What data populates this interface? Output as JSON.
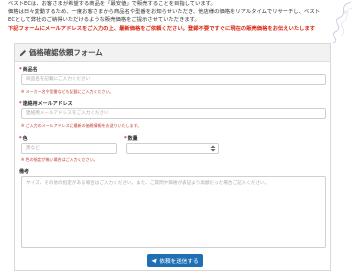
{
  "intro": {
    "line1": "ベストECは、お客さまが希望する商品を「最安値」で販売することを目指しています。",
    "line2": "価格は日々変動するため、一度お客さまから商品名や型番をお知らせいただき、他店様の価格をリアルタイムでリサーチし、ベスト",
    "line3": "ECとして弊社のご納得いただけるような販売価格をご提示させていただきます。",
    "line4": "下記フォームにメールアドレスをご入力の上、最新価格をご依頼ください。登録不要ですぐに現在の販売価格をお伝えいたします"
  },
  "form": {
    "title": "価格確認依頼フォーム",
    "product": {
      "label": "商品名",
      "placeholder": "商品名を記載にご入力ください",
      "hint": "※ メーカー名や型番なども記載にご入力ください。"
    },
    "email": {
      "label": "連絡用メールアドレス",
      "placeholder": "連絡用メールアドレスをご入力ください",
      "hint": "※ ご入力のメールアドレスに最新の価格情報をお送りいたします。"
    },
    "color": {
      "label": "色",
      "placeholder": "黒など",
      "hint": "※ 色の指定が無い場合はご入力ください。"
    },
    "quantity": {
      "label": "数量"
    },
    "notes": {
      "label": "備考",
      "placeholder": "サイズ、その他の指定がある場合はご入力ください。また、ご質問や価格が表記より高額だった場合ご記入ください。"
    },
    "submit_label": "依頼を送信する"
  },
  "colors": {
    "accent": "#1f6fb5",
    "required": "#d9230f"
  }
}
